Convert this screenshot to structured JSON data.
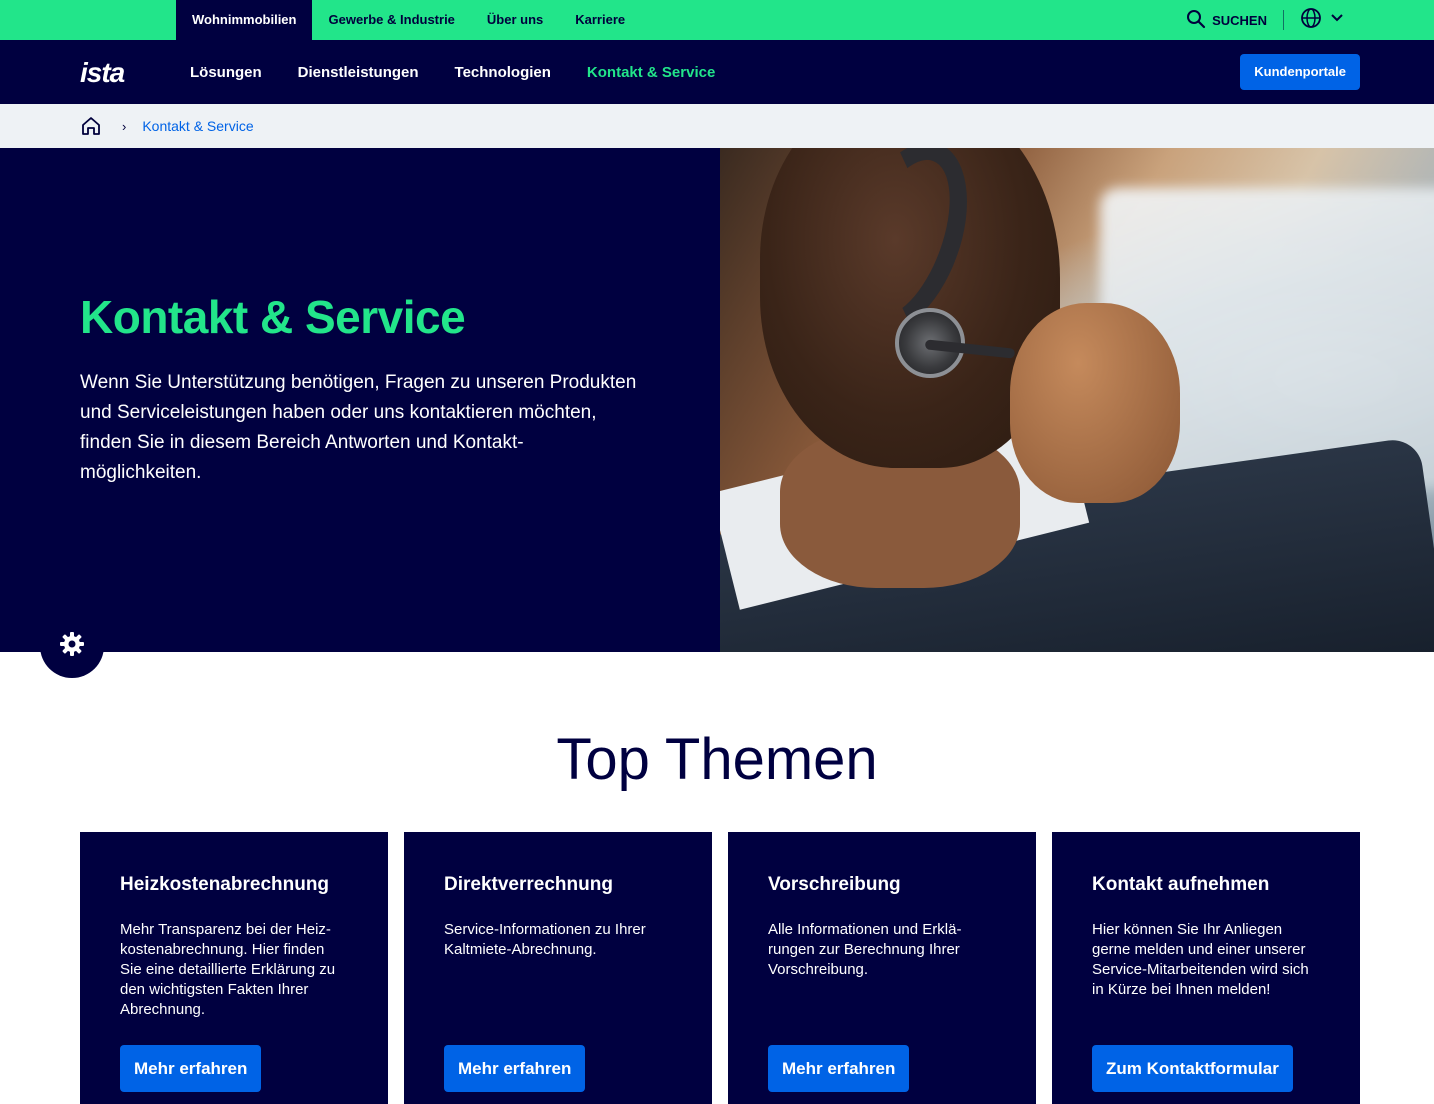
{
  "topbar": {
    "segments": [
      "Wohnimmobilien",
      "Gewerbe & Industrie",
      "Über uns",
      "Karriere"
    ],
    "search_label": "SUCHEN"
  },
  "header": {
    "logo": "ista",
    "nav": [
      "Lösungen",
      "Dienstleistungen",
      "Technologien",
      "Kontakt & Service"
    ],
    "portal_button": "Kundenportale"
  },
  "breadcrumb": {
    "current": "Kontakt & Service"
  },
  "hero": {
    "title": "Kontakt & Service",
    "description": "Wenn Sie Unterstützung benötigen, Fragen zu unseren Produkten und Serviceleistungen haben oder uns kontaktieren möchten, finden Sie in diesem Bereich Antworten und Kontakt-möglichkeiten."
  },
  "top_themen": {
    "title": "Top Themen",
    "cards": [
      {
        "title": "Heizkostenabrechnung",
        "text": "Mehr Transparenz bei der Heiz-kostenabrechnung. Hier finden Sie eine detaillierte Erklärung zu den wichtigsten Fakten Ihrer Abrechnung.",
        "button": "Mehr erfahren"
      },
      {
        "title": "Direktverrechnung",
        "text": "Service-Informationen zu Ihrer Kaltmiete-Abrechnung.",
        "button": "Mehr erfahren"
      },
      {
        "title": "Vorschreibung",
        "text": "Alle Informationen und Erklä-rungen zur Berechnung Ihrer Vorschreibung.",
        "button": "Mehr erfahren"
      },
      {
        "title": "Kontakt aufnehmen",
        "text": "Hier können Sie Ihr Anliegen gerne melden und einer unserer Service-Mitarbeitenden wird sich in Kürze bei Ihnen melden!",
        "button": "Zum Kontaktformular"
      }
    ]
  },
  "colors": {
    "navy": "#000040",
    "green": "#22e58a",
    "blue": "#0063e6"
  }
}
